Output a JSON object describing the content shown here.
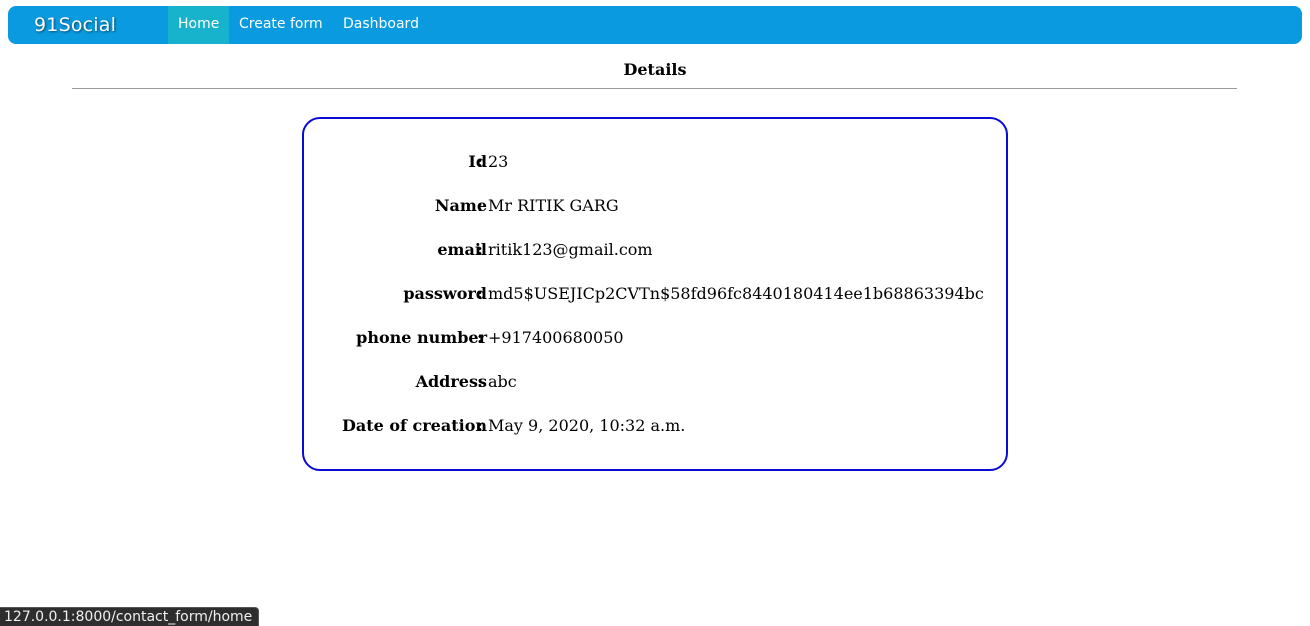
{
  "navbar": {
    "brand": "91Social",
    "items": [
      {
        "label": "Home",
        "active": true
      },
      {
        "label": "Create form",
        "active": false
      },
      {
        "label": "Dashboard",
        "active": false
      }
    ]
  },
  "page": {
    "title": "Details"
  },
  "details": {
    "colon": ":",
    "rows": [
      {
        "label": "Id",
        "value": "23"
      },
      {
        "label": "Name",
        "value": "Mr RITIK GARG"
      },
      {
        "label": "email",
        "value": "ritik123@gmail.com"
      },
      {
        "label": "password",
        "value": "md5$USEJICp2CVTn$58fd96fc8440180414ee1b68863394bc"
      },
      {
        "label": "phone number",
        "value": "+917400680050"
      },
      {
        "label": "Address",
        "value": "abc"
      },
      {
        "label": "Date of creation",
        "value": "May 9, 2020, 10:32 a.m."
      }
    ]
  },
  "status_bar": {
    "url": "127.0.0.1:8000/contact_form/home"
  },
  "colors": {
    "navbar": "#0a9ae0",
    "nav_active": "#17b3cc",
    "card_border": "#0a0ad8"
  }
}
